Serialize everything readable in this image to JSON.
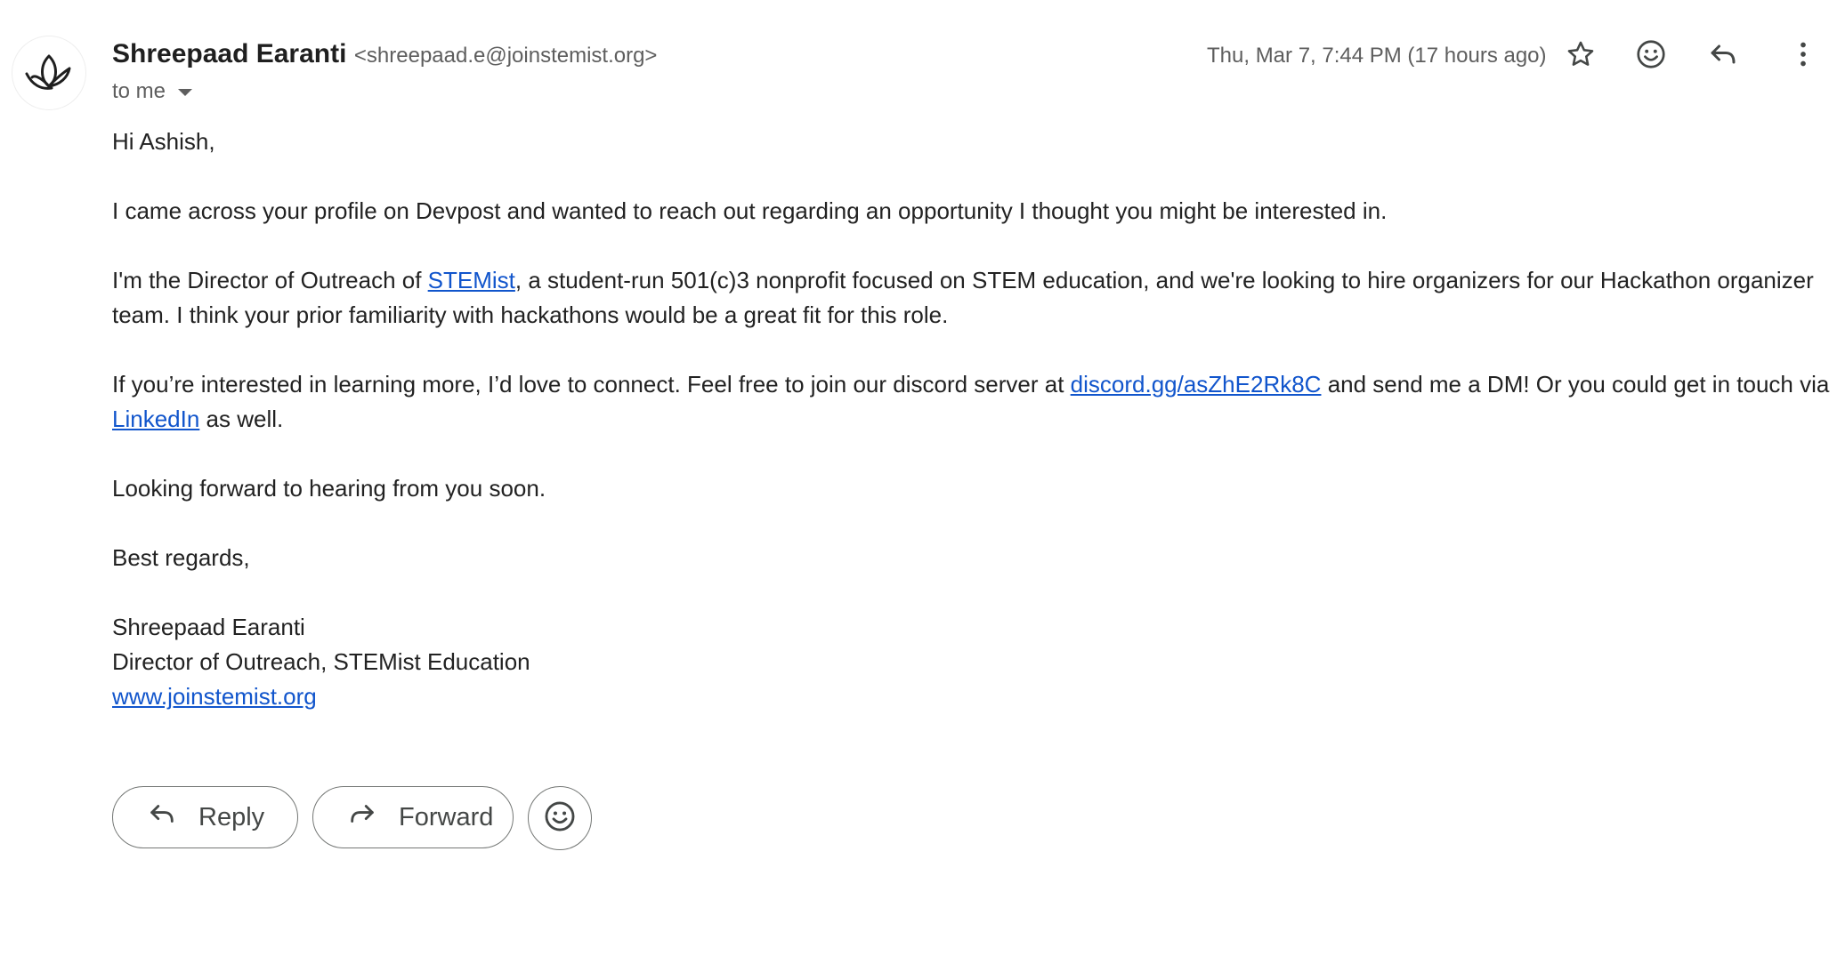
{
  "sender": {
    "name": "Shreepaad Earanti",
    "email": "<shreepaad.e@joinstemist.org>",
    "to_label": "to me"
  },
  "timestamp": "Thu, Mar 7, 7:44 PM (17 hours ago)",
  "header_icons": [
    "star-icon",
    "emoji-icon",
    "reply-icon",
    "more-vert-icon"
  ],
  "body": {
    "greeting": "Hi Ashish,",
    "p1": "I came across your profile on Devpost and wanted to reach out regarding an opportunity I thought you might be interested in.",
    "p2_pre": "I'm the Director of Outreach of ",
    "p2_link": "STEMist",
    "p2_post": ", a student-run 501(c)3 nonprofit focused on STEM education, and we're looking to hire organizers for our Hackathon organizer team. I think your prior familiarity with hackathons would be a great fit for this role.",
    "p3_pre": "If you’re interested in learning more, I’d love to connect. Feel free to join our discord server at ",
    "p3_link1": "discord.gg/asZhE2Rk8C",
    "p3_mid": " and send me a DM! Or you could get in touch via ",
    "p3_link2": "LinkedIn",
    "p3_post": " as well.",
    "p4": "Looking forward to hearing from you soon.",
    "closing": "Best regards,",
    "sig_name": "Shreepaad Earanti",
    "sig_title": "Director of Outreach, STEMist Education",
    "sig_url": "www.joinstemist.org"
  },
  "actions": {
    "reply_label": "Reply",
    "forward_label": "Forward"
  },
  "colors": {
    "link": "#1155cc",
    "muted": "#5e5e5e",
    "icon": "#444746"
  }
}
